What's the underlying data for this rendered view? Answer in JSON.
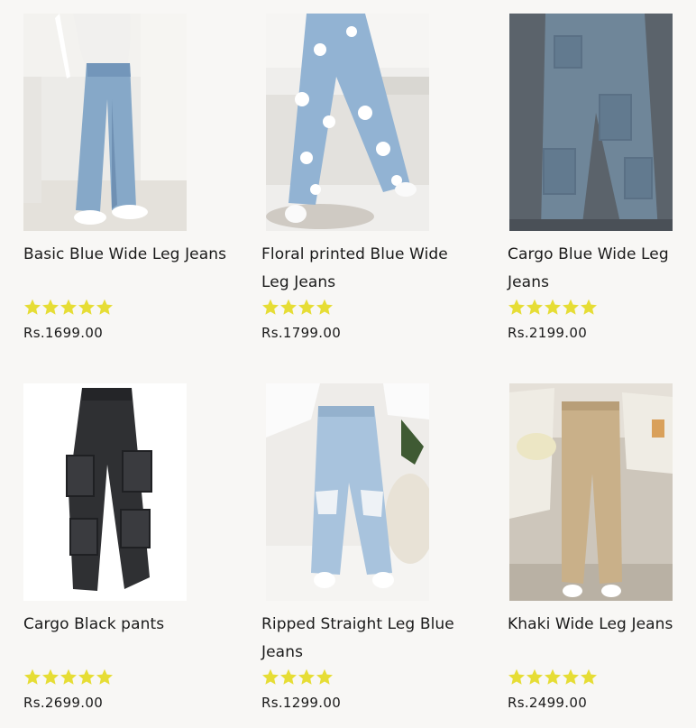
{
  "products": [
    {
      "name": "Basic Blue Wide Leg Jeans",
      "rating": 5,
      "price": "Rs.1699.00",
      "image": "basic-blue-wide-leg-jeans-photo"
    },
    {
      "name": "Floral printed Blue Wide Leg Jeans",
      "rating": 4,
      "price": "Rs.1799.00",
      "image": "floral-printed-jeans-photo"
    },
    {
      "name": "Cargo Blue Wide Leg Jeans",
      "rating": 5,
      "price": "Rs.2199.00",
      "image": "cargo-blue-jeans-photo"
    },
    {
      "name": "Cargo Black pants",
      "rating": 5,
      "price": "Rs.2699.00",
      "image": "cargo-black-pants-photo"
    },
    {
      "name": "Ripped Straight Leg Blue Jeans",
      "rating": 4,
      "price": "Rs.1299.00",
      "image": "ripped-straight-jeans-photo"
    },
    {
      "name": "Khaki Wide Leg Jeans",
      "rating": 5,
      "price": "Rs.2499.00",
      "image": "khaki-wide-leg-jeans-photo"
    }
  ],
  "colors": {
    "star": "#e6dd35",
    "background": "#f8f7f5",
    "text": "#1a1a1a"
  }
}
